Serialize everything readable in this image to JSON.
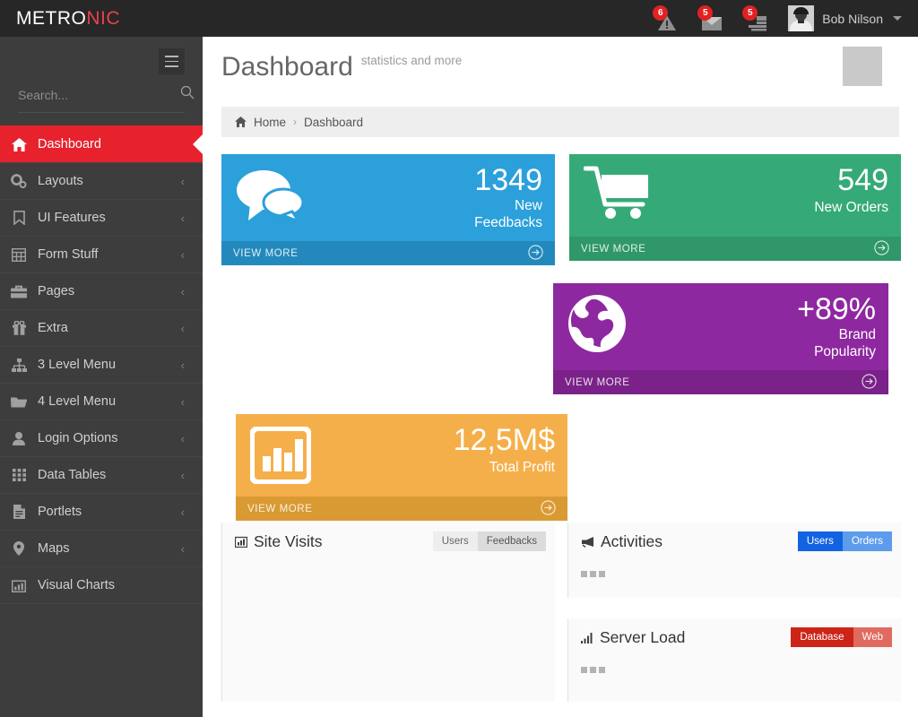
{
  "brand": {
    "part1": "METRO",
    "part2": "NIC"
  },
  "topbar": {
    "notifications": [
      {
        "icon": "warning-icon",
        "count": "6"
      },
      {
        "icon": "envelope-icon",
        "count": "5"
      },
      {
        "icon": "tasks-icon",
        "count": "5"
      }
    ],
    "user": {
      "name": "Bob Nilson"
    }
  },
  "sidebar": {
    "search": {
      "placeholder": "Search...",
      "value": ""
    },
    "items": [
      {
        "label": "Dashboard",
        "icon": "home-icon",
        "active": true,
        "chevron": ""
      },
      {
        "label": "Layouts",
        "icon": "gears-icon",
        "active": false,
        "chevron": "‹"
      },
      {
        "label": "UI Features",
        "icon": "bookmark-icon",
        "active": false,
        "chevron": "‹"
      },
      {
        "label": "Form Stuff",
        "icon": "table-icon",
        "active": false,
        "chevron": "‹"
      },
      {
        "label": "Pages",
        "icon": "briefcase-icon",
        "active": false,
        "chevron": "‹"
      },
      {
        "label": "Extra",
        "icon": "gift-icon",
        "active": false,
        "chevron": "‹"
      },
      {
        "label": "3 Level Menu",
        "icon": "sitemap-icon",
        "active": false,
        "chevron": "‹"
      },
      {
        "label": "4 Level Menu",
        "icon": "folder-icon",
        "active": false,
        "chevron": "‹"
      },
      {
        "label": "Login Options",
        "icon": "user-icon",
        "active": false,
        "chevron": "‹"
      },
      {
        "label": "Data Tables",
        "icon": "grid-icon",
        "active": false,
        "chevron": "‹"
      },
      {
        "label": "Portlets",
        "icon": "document-icon",
        "active": false,
        "chevron": "‹"
      },
      {
        "label": "Maps",
        "icon": "map-pin-icon",
        "active": false,
        "chevron": "‹"
      },
      {
        "label": "Visual Charts",
        "icon": "bar-chart-icon",
        "active": false,
        "chevron": ""
      }
    ]
  },
  "page": {
    "title": "Dashboard",
    "subtitle": "statistics and more",
    "breadcrumb": {
      "home": "Home",
      "separator": "›",
      "current": "Dashboard"
    }
  },
  "tiles": [
    {
      "number": "1349",
      "desc_line1": "New",
      "desc_line2": "Feedbacks",
      "footer": "VIEW MORE",
      "icon": "comments-icon",
      "color": "#2BA0DB"
    },
    {
      "number": "549",
      "desc_line1": "New Orders",
      "desc_line2": "",
      "footer": "VIEW MORE",
      "icon": "cart-icon",
      "color": "#35AA78"
    },
    {
      "number": "+89%",
      "desc_line1": "Brand",
      "desc_line2": "Popularity",
      "footer": "VIEW MORE",
      "icon": "globe-icon",
      "color": "#8E28A0"
    },
    {
      "number": "12,5M$",
      "desc_line1": "Total Profit",
      "desc_line2": "",
      "footer": "VIEW MORE",
      "icon": "bar-chart-icon",
      "color": "#F5AF4A"
    }
  ],
  "portlets": {
    "site_visits": {
      "title": "Site Visits",
      "icon": "bar-chart-icon",
      "buttons": [
        {
          "label": "Users",
          "active": false
        },
        {
          "label": "Feedbacks",
          "active": true
        }
      ]
    },
    "activities": {
      "title": "Activities",
      "icon": "bullhorn-icon",
      "buttons": [
        {
          "label": "Users",
          "active": true
        },
        {
          "label": "Orders",
          "active": false
        }
      ]
    },
    "server_load": {
      "title": "Server Load",
      "icon": "signal-icon",
      "buttons": [
        {
          "label": "Database",
          "active": true
        },
        {
          "label": "Web",
          "active": false
        }
      ]
    }
  }
}
